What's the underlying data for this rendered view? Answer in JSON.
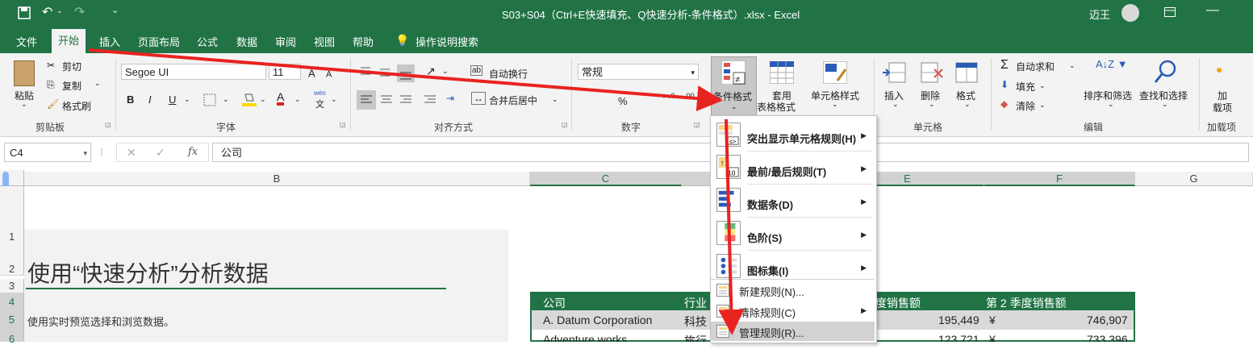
{
  "window": {
    "title": "S03+S04（Ctrl+E快速填充、Q快速分析-条件格式）.xlsx  -  Excel",
    "user": "迈王"
  },
  "tabs": [
    "文件",
    "开始",
    "插入",
    "页面布局",
    "公式",
    "数据",
    "审阅",
    "视图",
    "帮助"
  ],
  "tell_me": "操作说明搜索",
  "ribbon": {
    "clipboard": {
      "paste": "粘贴",
      "cut": "剪切",
      "copy": "复制",
      "format_painter": "格式刷",
      "label": "剪贴板"
    },
    "font": {
      "name": "Segoe UI",
      "size": "11",
      "bold": "B",
      "italic": "I",
      "underline": "U",
      "label": "字体",
      "font_color_letter": "A",
      "wen": "wén",
      "wen_char": "文"
    },
    "alignment": {
      "wrap": "自动换行",
      "merge": "合并后居中",
      "label": "对齐方式"
    },
    "number": {
      "format": "常规",
      "label": "数字",
      "percent": "%"
    },
    "styles": {
      "conditional": "条件格式",
      "table_fmt_1": "套用",
      "table_fmt_2": "表格格式",
      "cell_styles": "单元格样式"
    },
    "cells": {
      "insert": "插入",
      "delete": "删除",
      "format": "格式",
      "label": "单元格"
    },
    "editing": {
      "autosum": "自动求和",
      "fill": "填充",
      "clear": "清除",
      "sort": "排序和筛选",
      "find": "查找和选择",
      "label": "编辑"
    },
    "addins": {
      "line1": "加",
      "line2": "载项",
      "label": "加载项"
    }
  },
  "formula_bar": {
    "name_box": "C4",
    "value": "公司",
    "fx": "fx"
  },
  "columns": [
    "B",
    "C",
    "E",
    "F",
    "G"
  ],
  "rows": [
    "1",
    "2",
    "3",
    "4",
    "5",
    "6"
  ],
  "sheet": {
    "heading": "使用“快速分析”分析数据",
    "subtitle": "使用实时预览选择和浏览数据。",
    "table_headers": {
      "company": "公司",
      "industry": "行业",
      "q1": "度销售额",
      "q2": "第 2 季度销售额"
    },
    "rows": [
      {
        "company": "A. Datum Corporation",
        "industry": "科技",
        "q1": "195,449",
        "cur": "¥",
        "q2": "746,907"
      },
      {
        "company": "Adventure works",
        "industry": "旅行",
        "q1": "123,721",
        "cur": "¥",
        "q2": "733,396"
      }
    ]
  },
  "menu": {
    "items": [
      {
        "label": "突出显示单元格规则(H)",
        "submenu": true
      },
      {
        "label": "最前/最后规则(T)",
        "submenu": true
      },
      {
        "label": "数据条(D)",
        "submenu": true
      },
      {
        "label": "色阶(S)",
        "submenu": true
      },
      {
        "label": "图标集(I)",
        "submenu": true
      },
      {
        "label": "新建规则(N)...",
        "submenu": false
      },
      {
        "label": "清除规则(C)",
        "submenu": true
      },
      {
        "label": "管理规则(R)...",
        "submenu": false
      }
    ]
  },
  "colors": {
    "excel_green": "#217346",
    "arrow_red": "#e8231f"
  }
}
